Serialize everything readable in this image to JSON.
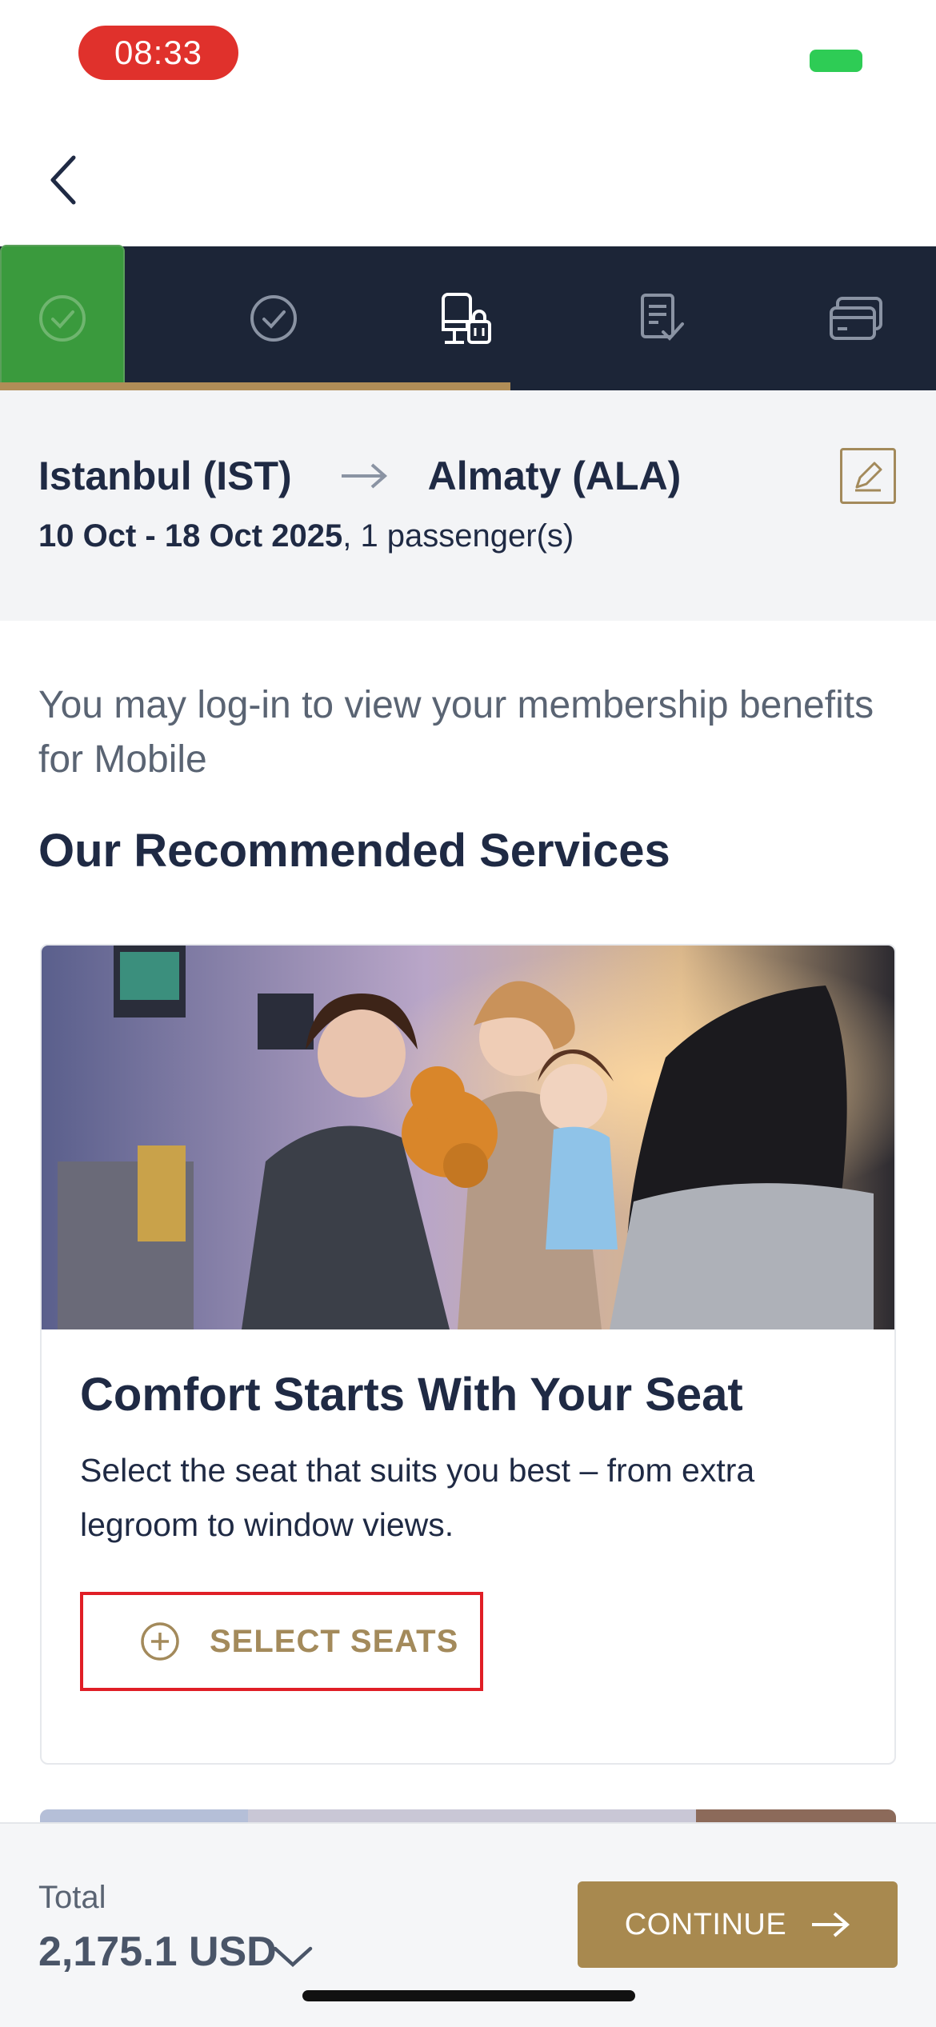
{
  "status": {
    "time": "08:33"
  },
  "route": {
    "origin": "Istanbul (IST)",
    "destination": "Almaty (ALA)",
    "dates": "10 Oct - 18 Oct 2025",
    "passengers": ", 1 passenger(s)"
  },
  "stepper": {
    "steps": [
      "check-icon",
      "check-icon",
      "seat-icon",
      "document-check-icon",
      "card-icon"
    ],
    "progress_fraction": 0.545
  },
  "login_prompt": "You may log-in to view your membership benefits for Mobile",
  "section_title": "Our Recommended Services",
  "card": {
    "title": "Comfort Starts With Your Seat",
    "description": "Select the seat that suits you best – from extra legroom to window views.",
    "button_label": "SELECT SEATS"
  },
  "footer": {
    "total_label": "Total",
    "total_value": "2,175.1 USD",
    "continue_label": "CONTINUE"
  },
  "colors": {
    "navy": "#1c2537",
    "gold": "#a8894f",
    "green": "#3a9a3d",
    "highlight_red": "#e01e26"
  }
}
